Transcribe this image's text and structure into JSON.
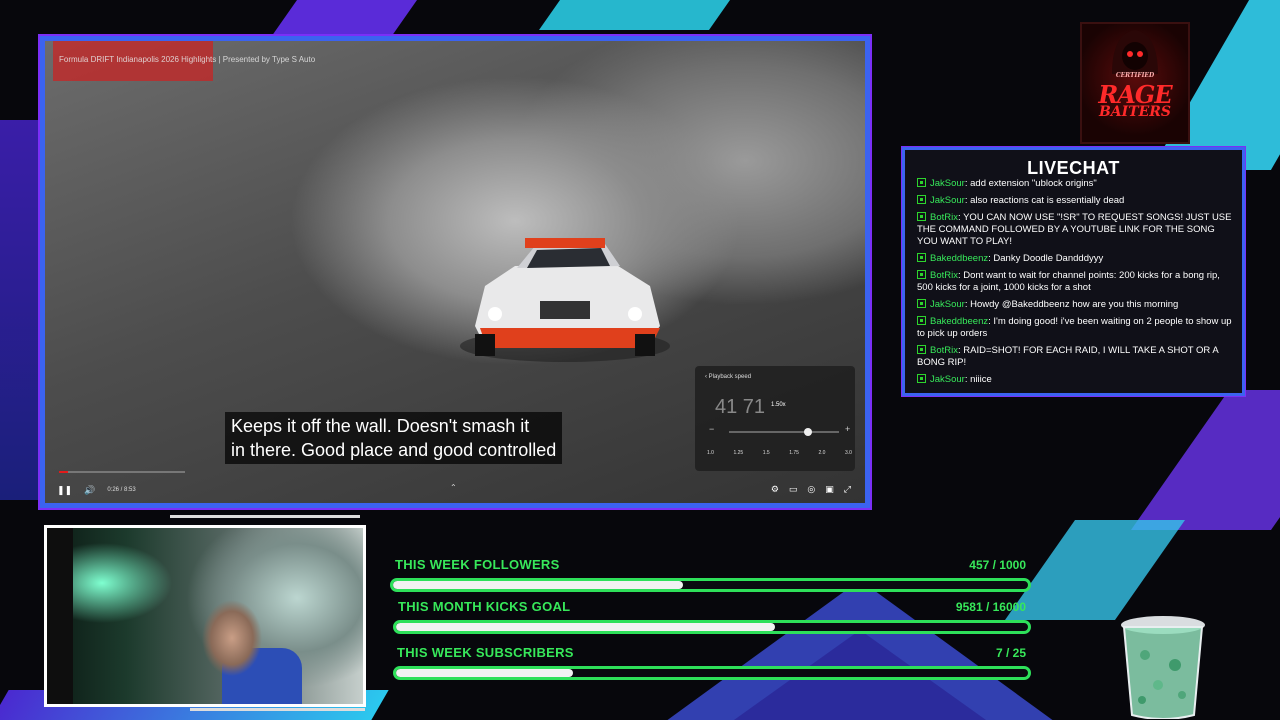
{
  "video": {
    "title": "Formula DRIFT Indianapolis 2026 Highlights | Presented by Type S Auto",
    "subtitle_line1": "Keeps it off the wall. Doesn't smash it",
    "subtitle_line2": "in there. Good place and good controlled",
    "time": "0:26 / 8:53",
    "progress_fraction": 0.07,
    "speed_panel": {
      "header": "Playback speed",
      "current": "1.50x",
      "big_display": "41   71",
      "slider_fraction": 0.68,
      "chips": [
        "1.0",
        "1.25",
        "1.5",
        "1.75",
        "2.0",
        "3.0"
      ],
      "minus": "−",
      "plus": "+"
    },
    "icons": {
      "play_pause": "pause-icon",
      "volume": "volume-icon",
      "settings": "gear-icon",
      "captions": "captions-icon",
      "cast": "cast-icon",
      "miniplayer": "miniplayer-icon",
      "fullscreen": "fullscreen-icon",
      "expand": "chevron-up-icon"
    }
  },
  "logo": {
    "line_top": "CERTIFIED",
    "line_main": "RAGE",
    "line_sub": "BAITERS"
  },
  "chat": {
    "title": "LIVECHAT",
    "messages": [
      {
        "user": "JakSour",
        "text": ": add extension \"ublock origins\""
      },
      {
        "user": "JakSour",
        "text": ": also reactions cat is essentially dead"
      },
      {
        "user": "BotRix",
        "text": ": YOU CAN NOW USE \"!SR\" TO REQUEST SONGS! JUST USE THE COMMAND FOLLOWED BY A YOUTUBE LINK FOR THE SONG YOU WANT TO PLAY!"
      },
      {
        "user": "Bakeddbeenz",
        "text": ": Danky Doodle Dandddyyy"
      },
      {
        "user": "BotRix",
        "text": ": Dont want to wait for channel points: 200 kicks for a bong rip, 500 kicks for a joint, 1000 kicks for a shot"
      },
      {
        "user": "JakSour",
        "text": ": Howdy @Bakeddbeenz how are you this morning"
      },
      {
        "user": "Bakeddbeenz",
        "text": ": I'm doing good! i've been waiting on 2 people to show up to pick up orders"
      },
      {
        "user": "BotRix",
        "text": ": RAID=SHOT! FOR EACH RAID, I WILL TAKE A SHOT OR A BONG RIP!"
      },
      {
        "user": "JakSour",
        "text": ": niiice"
      }
    ],
    "colors": {
      "user": "#37e85a",
      "border": "#3b63f0"
    }
  },
  "goals": [
    {
      "label": "THIS WEEK FOLLOWERS",
      "count": "457 / 1000",
      "fraction": 0.457
    },
    {
      "label": "THIS MONTH KICKS GOAL",
      "count": "9581 / 16000",
      "fraction": 0.599
    },
    {
      "label": "THIS WEEK SUBSCRIBERS",
      "count": "7 / 25",
      "fraction": 0.28
    }
  ],
  "theme": {
    "accent_green": "#37e85a",
    "accent_blue": "#3b63f0",
    "accent_purple": "#7b2ff7",
    "accent_cyan": "#2bd6f0"
  }
}
